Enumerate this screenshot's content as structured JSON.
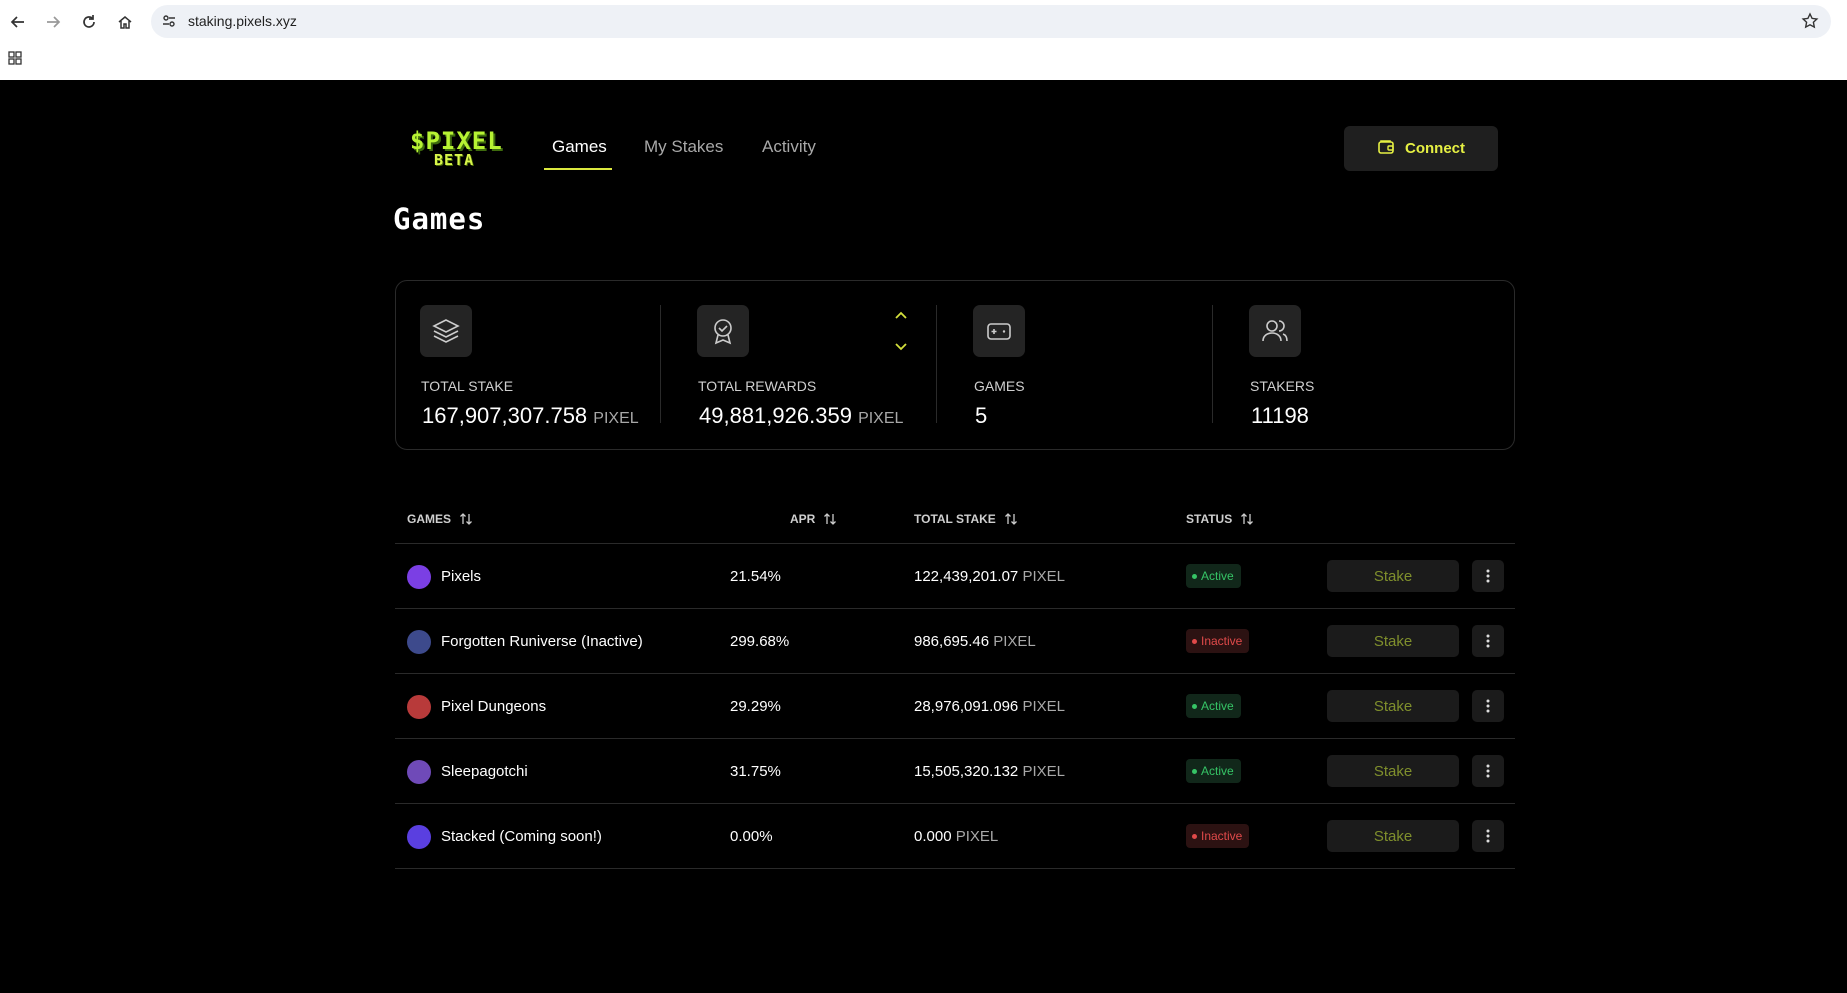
{
  "browser": {
    "url": "staking.pixels.xyz",
    "icons": [
      "back-icon",
      "forward-icon",
      "reload-icon",
      "home-icon",
      "site-settings-icon",
      "bookmark-star-icon",
      "apps-grid-icon"
    ]
  },
  "header": {
    "logo_line1": "$PIXEL",
    "logo_line2": "BETA",
    "nav": [
      "Games",
      "My Stakes",
      "Activity"
    ],
    "active_nav": "Games",
    "connect_label": "Connect"
  },
  "page_title": "Games",
  "stats": [
    {
      "icon": "layers-icon",
      "label": "TOTAL STAKE",
      "value": "167,907,307.758",
      "unit": "PIXEL"
    },
    {
      "icon": "award-badge-icon",
      "label": "TOTAL REWARDS",
      "value": "49,881,926.359",
      "unit": "PIXEL"
    },
    {
      "icon": "gamepad-icon",
      "label": "GAMES",
      "value": "5",
      "unit": ""
    },
    {
      "icon": "users-icon",
      "label": "STAKERS",
      "value": "11198",
      "unit": ""
    }
  ],
  "table": {
    "headers": [
      "GAMES",
      "APR",
      "TOTAL STAKE",
      "STATUS"
    ],
    "stake_label": "Stake",
    "rows": [
      {
        "name": "Pixels",
        "apr": "21.54%",
        "stake": "122,439,201.07",
        "unit": "PIXEL",
        "status": "Active",
        "icon_color": "#7b3fe4"
      },
      {
        "name": "Forgotten Runiverse (Inactive)",
        "apr": "299.68%",
        "stake": "986,695.46",
        "unit": "PIXEL",
        "status": "Inactive",
        "icon_color": "#3d4a8c"
      },
      {
        "name": "Pixel Dungeons",
        "apr": "29.29%",
        "stake": "28,976,091.096",
        "unit": "PIXEL",
        "status": "Active",
        "icon_color": "#b83a3a"
      },
      {
        "name": "Sleepagotchi",
        "apr": "31.75%",
        "stake": "15,505,320.132",
        "unit": "PIXEL",
        "status": "Active",
        "icon_color": "#6f4ab8"
      },
      {
        "name": "Stacked (Coming soon!)",
        "apr": "0.00%",
        "stake": "0.000",
        "unit": "PIXEL",
        "status": "Inactive",
        "icon_color": "#5a3fe0"
      }
    ]
  },
  "colors": {
    "accent": "#e6f043",
    "active_green": "#36c466",
    "inactive_red": "#e04a4a",
    "background": "#000000"
  }
}
